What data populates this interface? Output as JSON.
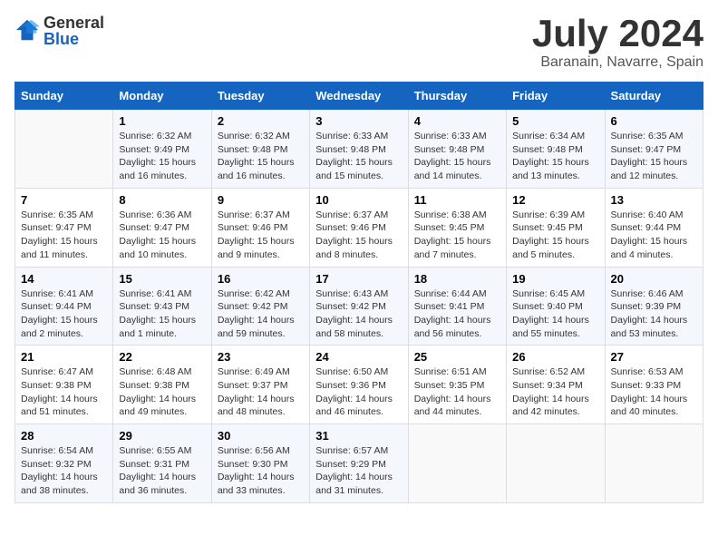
{
  "header": {
    "logo_general": "General",
    "logo_blue": "Blue",
    "title_month": "July 2024",
    "title_location": "Baranain, Navarre, Spain"
  },
  "calendar": {
    "days_of_week": [
      "Sunday",
      "Monday",
      "Tuesday",
      "Wednesday",
      "Thursday",
      "Friday",
      "Saturday"
    ],
    "weeks": [
      [
        {
          "day": "",
          "info": ""
        },
        {
          "day": "1",
          "info": "Sunrise: 6:32 AM\nSunset: 9:49 PM\nDaylight: 15 hours\nand 16 minutes."
        },
        {
          "day": "2",
          "info": "Sunrise: 6:32 AM\nSunset: 9:48 PM\nDaylight: 15 hours\nand 16 minutes."
        },
        {
          "day": "3",
          "info": "Sunrise: 6:33 AM\nSunset: 9:48 PM\nDaylight: 15 hours\nand 15 minutes."
        },
        {
          "day": "4",
          "info": "Sunrise: 6:33 AM\nSunset: 9:48 PM\nDaylight: 15 hours\nand 14 minutes."
        },
        {
          "day": "5",
          "info": "Sunrise: 6:34 AM\nSunset: 9:48 PM\nDaylight: 15 hours\nand 13 minutes."
        },
        {
          "day": "6",
          "info": "Sunrise: 6:35 AM\nSunset: 9:47 PM\nDaylight: 15 hours\nand 12 minutes."
        }
      ],
      [
        {
          "day": "7",
          "info": "Sunrise: 6:35 AM\nSunset: 9:47 PM\nDaylight: 15 hours\nand 11 minutes."
        },
        {
          "day": "8",
          "info": "Sunrise: 6:36 AM\nSunset: 9:47 PM\nDaylight: 15 hours\nand 10 minutes."
        },
        {
          "day": "9",
          "info": "Sunrise: 6:37 AM\nSunset: 9:46 PM\nDaylight: 15 hours\nand 9 minutes."
        },
        {
          "day": "10",
          "info": "Sunrise: 6:37 AM\nSunset: 9:46 PM\nDaylight: 15 hours\nand 8 minutes."
        },
        {
          "day": "11",
          "info": "Sunrise: 6:38 AM\nSunset: 9:45 PM\nDaylight: 15 hours\nand 7 minutes."
        },
        {
          "day": "12",
          "info": "Sunrise: 6:39 AM\nSunset: 9:45 PM\nDaylight: 15 hours\nand 5 minutes."
        },
        {
          "day": "13",
          "info": "Sunrise: 6:40 AM\nSunset: 9:44 PM\nDaylight: 15 hours\nand 4 minutes."
        }
      ],
      [
        {
          "day": "14",
          "info": "Sunrise: 6:41 AM\nSunset: 9:44 PM\nDaylight: 15 hours\nand 2 minutes."
        },
        {
          "day": "15",
          "info": "Sunrise: 6:41 AM\nSunset: 9:43 PM\nDaylight: 15 hours\nand 1 minute."
        },
        {
          "day": "16",
          "info": "Sunrise: 6:42 AM\nSunset: 9:42 PM\nDaylight: 14 hours\nand 59 minutes."
        },
        {
          "day": "17",
          "info": "Sunrise: 6:43 AM\nSunset: 9:42 PM\nDaylight: 14 hours\nand 58 minutes."
        },
        {
          "day": "18",
          "info": "Sunrise: 6:44 AM\nSunset: 9:41 PM\nDaylight: 14 hours\nand 56 minutes."
        },
        {
          "day": "19",
          "info": "Sunrise: 6:45 AM\nSunset: 9:40 PM\nDaylight: 14 hours\nand 55 minutes."
        },
        {
          "day": "20",
          "info": "Sunrise: 6:46 AM\nSunset: 9:39 PM\nDaylight: 14 hours\nand 53 minutes."
        }
      ],
      [
        {
          "day": "21",
          "info": "Sunrise: 6:47 AM\nSunset: 9:38 PM\nDaylight: 14 hours\nand 51 minutes."
        },
        {
          "day": "22",
          "info": "Sunrise: 6:48 AM\nSunset: 9:38 PM\nDaylight: 14 hours\nand 49 minutes."
        },
        {
          "day": "23",
          "info": "Sunrise: 6:49 AM\nSunset: 9:37 PM\nDaylight: 14 hours\nand 48 minutes."
        },
        {
          "day": "24",
          "info": "Sunrise: 6:50 AM\nSunset: 9:36 PM\nDaylight: 14 hours\nand 46 minutes."
        },
        {
          "day": "25",
          "info": "Sunrise: 6:51 AM\nSunset: 9:35 PM\nDaylight: 14 hours\nand 44 minutes."
        },
        {
          "day": "26",
          "info": "Sunrise: 6:52 AM\nSunset: 9:34 PM\nDaylight: 14 hours\nand 42 minutes."
        },
        {
          "day": "27",
          "info": "Sunrise: 6:53 AM\nSunset: 9:33 PM\nDaylight: 14 hours\nand 40 minutes."
        }
      ],
      [
        {
          "day": "28",
          "info": "Sunrise: 6:54 AM\nSunset: 9:32 PM\nDaylight: 14 hours\nand 38 minutes."
        },
        {
          "day": "29",
          "info": "Sunrise: 6:55 AM\nSunset: 9:31 PM\nDaylight: 14 hours\nand 36 minutes."
        },
        {
          "day": "30",
          "info": "Sunrise: 6:56 AM\nSunset: 9:30 PM\nDaylight: 14 hours\nand 33 minutes."
        },
        {
          "day": "31",
          "info": "Sunrise: 6:57 AM\nSunset: 9:29 PM\nDaylight: 14 hours\nand 31 minutes."
        },
        {
          "day": "",
          "info": ""
        },
        {
          "day": "",
          "info": ""
        },
        {
          "day": "",
          "info": ""
        }
      ]
    ]
  }
}
